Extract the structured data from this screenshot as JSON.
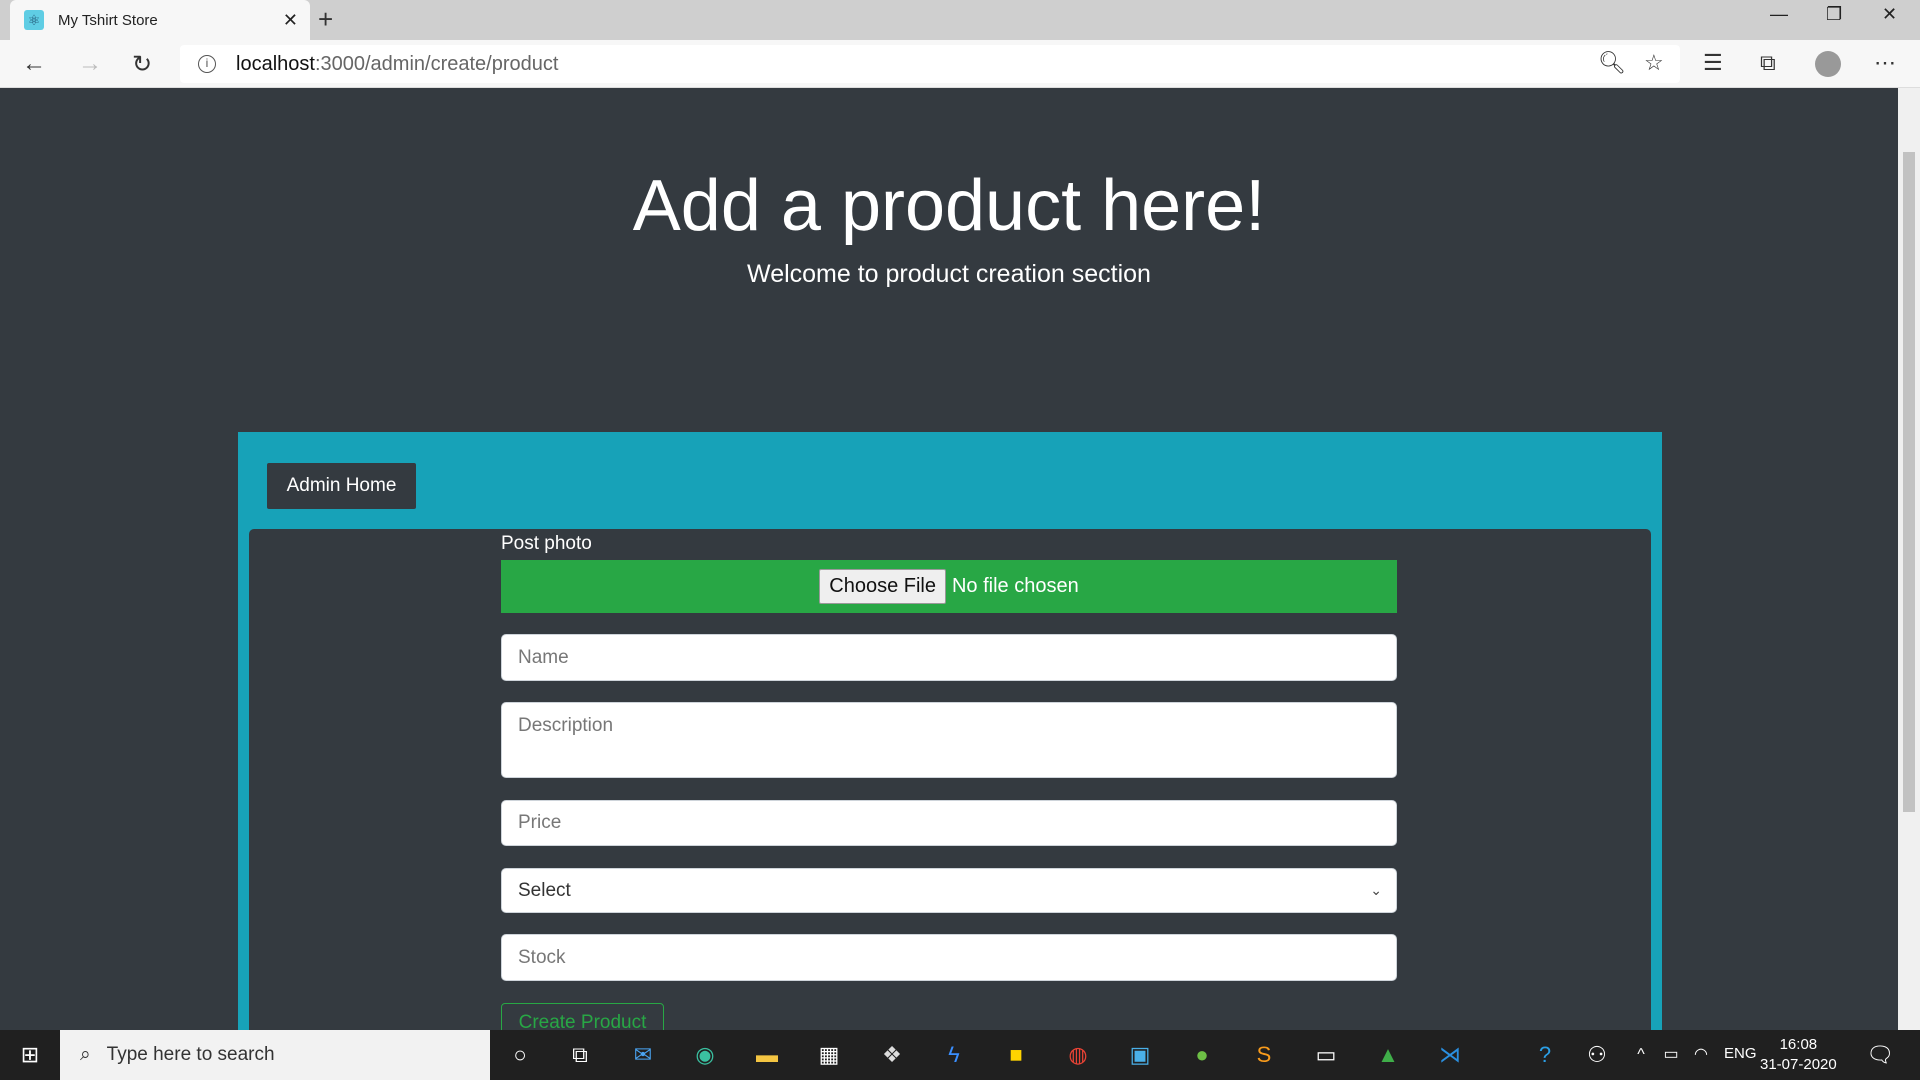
{
  "browser": {
    "tab_title": "My Tshirt Store",
    "url_host": "localhost",
    "url_path": ":3000/admin/create/product"
  },
  "page": {
    "title": "Add a product here!",
    "subtitle": "Welcome to product creation section",
    "admin_home": "Admin Home"
  },
  "form": {
    "photo_label": "Post photo",
    "choose_file": "Choose File",
    "no_file": "No file chosen",
    "name_placeholder": "Name",
    "description_placeholder": "Description",
    "price_placeholder": "Price",
    "category_selected": "Select",
    "stock_placeholder": "Stock",
    "submit": "Create Product"
  },
  "colors": {
    "background": "#343a40",
    "teal": "#17a2b8",
    "success": "#28a745"
  },
  "taskbar": {
    "search_placeholder": "Type here to search",
    "language": "ENG",
    "time": "16:08",
    "date": "31-07-2020"
  }
}
